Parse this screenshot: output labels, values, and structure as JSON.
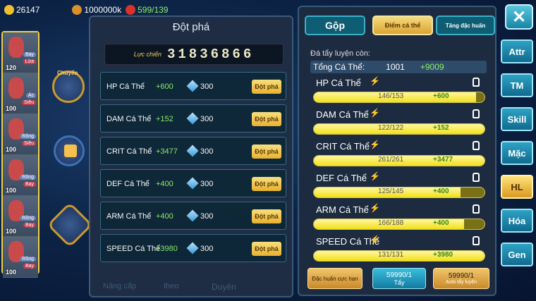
{
  "topbar": {
    "gold": "26147",
    "gold2": "1000000k",
    "energy": "599/139"
  },
  "left_panel": {
    "title": "Đột phá",
    "power_label": "Lực chiến",
    "power_value": "31836866",
    "rows": [
      {
        "name": "HP Cá Thể",
        "increase": "+600",
        "cost": "300",
        "button": "Đột phá"
      },
      {
        "name": "DAM Cá Thể",
        "increase": "+152",
        "cost": "300",
        "button": "Đột phá"
      },
      {
        "name": "CRIT Cá Thể",
        "increase": "+3477",
        "cost": "300",
        "button": "Đột phá"
      },
      {
        "name": "DEF Cá Thể",
        "increase": "+400",
        "cost": "300",
        "button": "Đột phá"
      },
      {
        "name": "ARM Cá Thể",
        "increase": "+400",
        "cost": "300",
        "button": "Đột phá"
      },
      {
        "name": "SPEED Cá Thể",
        "increase": "+3980",
        "cost": "300",
        "button": "Đột phá"
      }
    ]
  },
  "right_panel": {
    "tabs": [
      "Gộp",
      "Điểm cá thể",
      "Tăng đặc huấn"
    ],
    "remaining_label": "Đá tẩy luyện còn:",
    "total": {
      "label": "Tổng Cá Thể:",
      "value": "1001",
      "plus": "+9009"
    },
    "stats": [
      {
        "name": "HP Cá Thể",
        "value": "146/153",
        "add": "+600",
        "fraction": 0.95
      },
      {
        "name": "DAM Cá Thể",
        "value": "122/122",
        "add": "+152",
        "fraction": 1.0
      },
      {
        "name": "CRIT Cá Thể",
        "value": "261/261",
        "add": "+3477",
        "fraction": 1.0
      },
      {
        "name": "DEF Cá Thể",
        "value": "125/145",
        "add": "+400",
        "fraction": 0.86
      },
      {
        "name": "ARM Cá Thể",
        "value": "166/188",
        "add": "+400",
        "fraction": 0.88
      },
      {
        "name": "SPEED Cá Thể",
        "value": "131/131",
        "add": "+3980",
        "fraction": 1.0
      }
    ],
    "bottom": {
      "special": "Đặc huấn cực hạn",
      "wash_count": "59990/1",
      "wash_label": "Tẩy",
      "auto_count": "59990/1",
      "auto_label": "Auto tẩy luyện"
    }
  },
  "side_menu": [
    "Attr",
    "TM",
    "Skill",
    "Mặc",
    "HL",
    "Hóa",
    "Gen"
  ],
  "heroes": [
    {
      "level": "120",
      "tag1": "Bay",
      "tag2": "Lửa"
    },
    {
      "level": "100",
      "tag1": "Ác",
      "tag2": "Siêu"
    },
    {
      "level": "100",
      "tag1": "Rồng",
      "tag2": "Siêu"
    },
    {
      "level": "100",
      "tag1": "Rồng",
      "tag2": "Bay"
    },
    {
      "level": "100",
      "tag1": "Rồng",
      "tag2": "Bay"
    },
    {
      "level": "100",
      "tag1": "Rồng",
      "tag2": "Bay"
    }
  ],
  "bottom_bg": {
    "upgrade": "Nâng cấp",
    "follow": "theo",
    "fate": "Duyên"
  },
  "left_labels": {
    "chuyen": "Chuyển"
  },
  "colors": {
    "accent": "#f2e018",
    "green": "#8ef06a",
    "panel": "#1f2e44"
  }
}
